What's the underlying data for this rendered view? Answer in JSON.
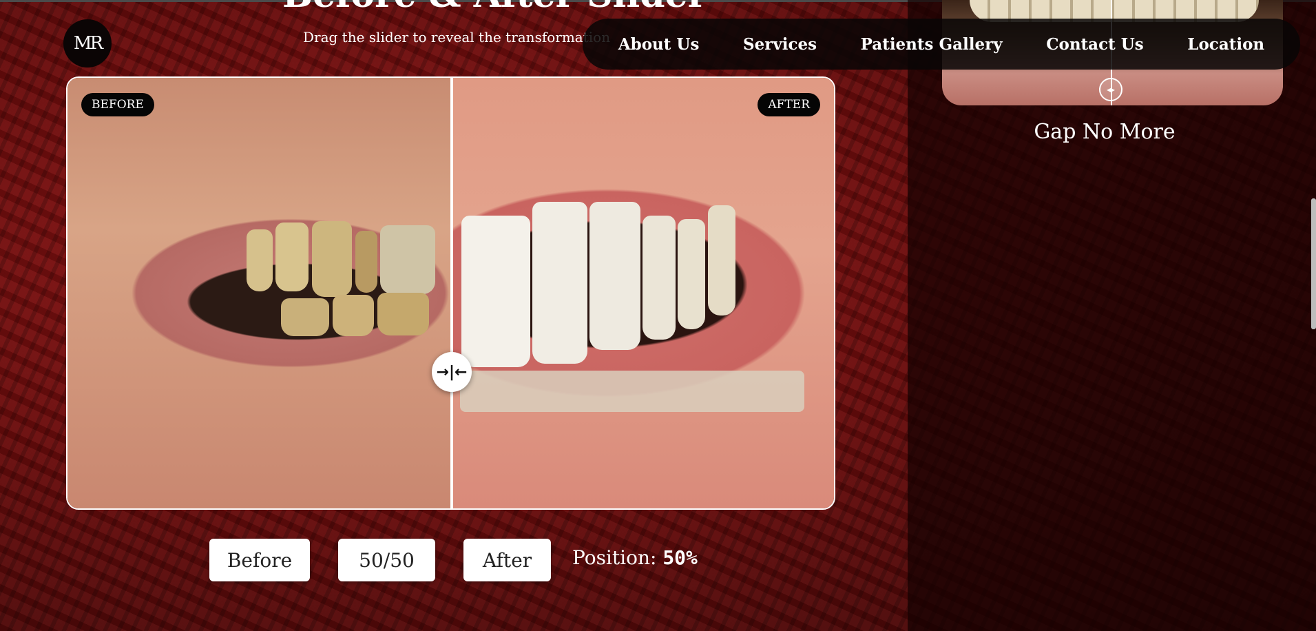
{
  "header": {
    "logo_text": "MR",
    "heading": "Before & After Slider",
    "subtitle": "Drag the slider to reveal the transformation"
  },
  "nav": {
    "items": [
      "About Us",
      "Services",
      "Patients Gallery",
      "Contact Us",
      "Location"
    ]
  },
  "comparison": {
    "before_label": "BEFORE",
    "after_label": "AFTER",
    "handle_symbol": "→|←",
    "position_percent": 50
  },
  "controls": {
    "before_button": "Before",
    "half_button": "50/50",
    "after_button": "After",
    "position_label": "Position:",
    "position_value": "50%"
  },
  "sidebar": {
    "card_caption": "Gap No More",
    "handle_symbol": "◂▸"
  }
}
